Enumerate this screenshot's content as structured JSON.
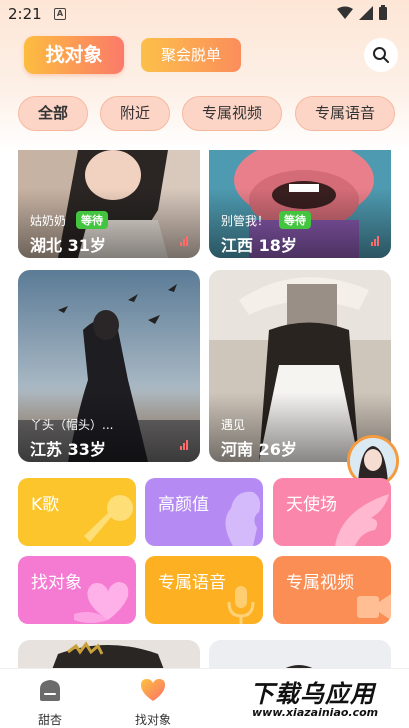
{
  "status_bar": {
    "time": "2:21",
    "app_icon": "A"
  },
  "header": {
    "tab_main": "找对象",
    "tab_second": "聚会脱单"
  },
  "filters": [
    "全部",
    "附近",
    "专属视频",
    "专属语音"
  ],
  "profiles": [
    {
      "nick": "姑奶奶",
      "badge": "等待",
      "location": "湖北 31岁"
    },
    {
      "nick": "别管我！",
      "badge": "等待",
      "location": "江西 18岁"
    },
    {
      "nick": "丫头（帽头）...",
      "badge": "",
      "location": "江苏 33岁"
    },
    {
      "nick": "遇见",
      "badge": "",
      "location": "河南 26岁"
    }
  ],
  "categories": [
    {
      "label": "K歌",
      "color": "#fbc52b",
      "icon": "microphone-icon"
    },
    {
      "label": "高颜值",
      "color": "#b58bf3",
      "icon": "face-profile-icon"
    },
    {
      "label": "天使场",
      "color": "#fb86ac",
      "icon": "wing-icon"
    },
    {
      "label": "找对象",
      "color": "#f57ad2",
      "icon": "heart-icon"
    },
    {
      "label": "专属语音",
      "color": "#fcb022",
      "icon": "mic-icon"
    },
    {
      "label": "专属视频",
      "color": "#fb8e55",
      "icon": "video-icon"
    }
  ],
  "bottom_nav": [
    {
      "label": "甜杏",
      "icon": "home-icon"
    },
    {
      "label": "找对象",
      "icon": "heart-icon"
    }
  ],
  "watermark": {
    "main": "下载乌应用",
    "sub": "www.xiazainiao.com"
  }
}
